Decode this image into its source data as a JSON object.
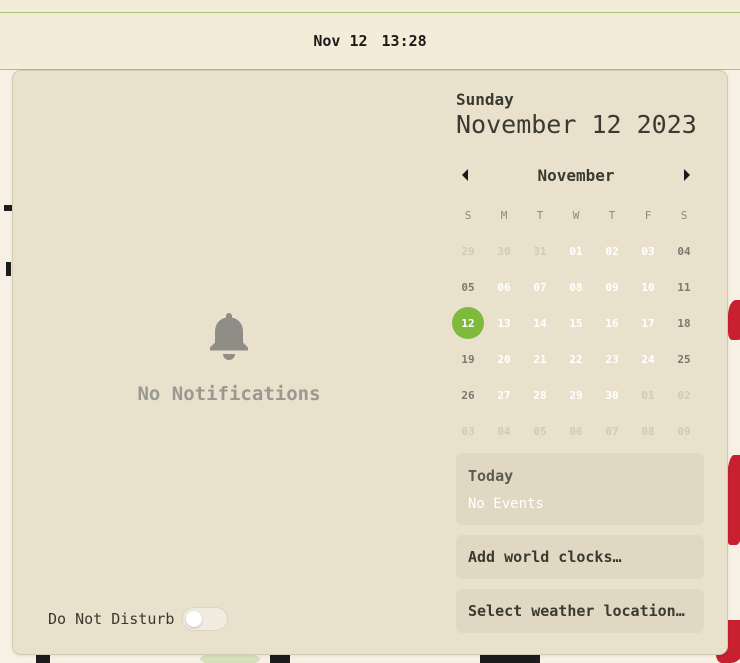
{
  "topbar": {
    "date": "Nov 12",
    "time": "13:28"
  },
  "notifications": {
    "empty_label": "No Notifications",
    "dnd_label": "Do Not Disturb",
    "dnd_enabled": false
  },
  "calendar": {
    "weekday": "Sunday",
    "full_date": "November 12 2023",
    "month_label": "November",
    "day_headers": [
      "S",
      "M",
      "T",
      "W",
      "T",
      "F",
      "S"
    ],
    "weeks": [
      [
        "29",
        "30",
        "31",
        "01",
        "02",
        "03",
        "04"
      ],
      [
        "05",
        "06",
        "07",
        "08",
        "09",
        "10",
        "11"
      ],
      [
        "12",
        "13",
        "14",
        "15",
        "16",
        "17",
        "18"
      ],
      [
        "19",
        "20",
        "21",
        "22",
        "23",
        "24",
        "25"
      ],
      [
        "26",
        "27",
        "28",
        "29",
        "30",
        "01",
        "02"
      ],
      [
        "03",
        "04",
        "05",
        "06",
        "07",
        "08",
        "09"
      ]
    ],
    "selected_day": "12",
    "accent_color": "#7fba3c"
  },
  "events": {
    "title": "Today",
    "empty_label": "No Events"
  },
  "world_clocks": {
    "label": "Add world clocks…"
  },
  "weather": {
    "label": "Select weather location…"
  }
}
